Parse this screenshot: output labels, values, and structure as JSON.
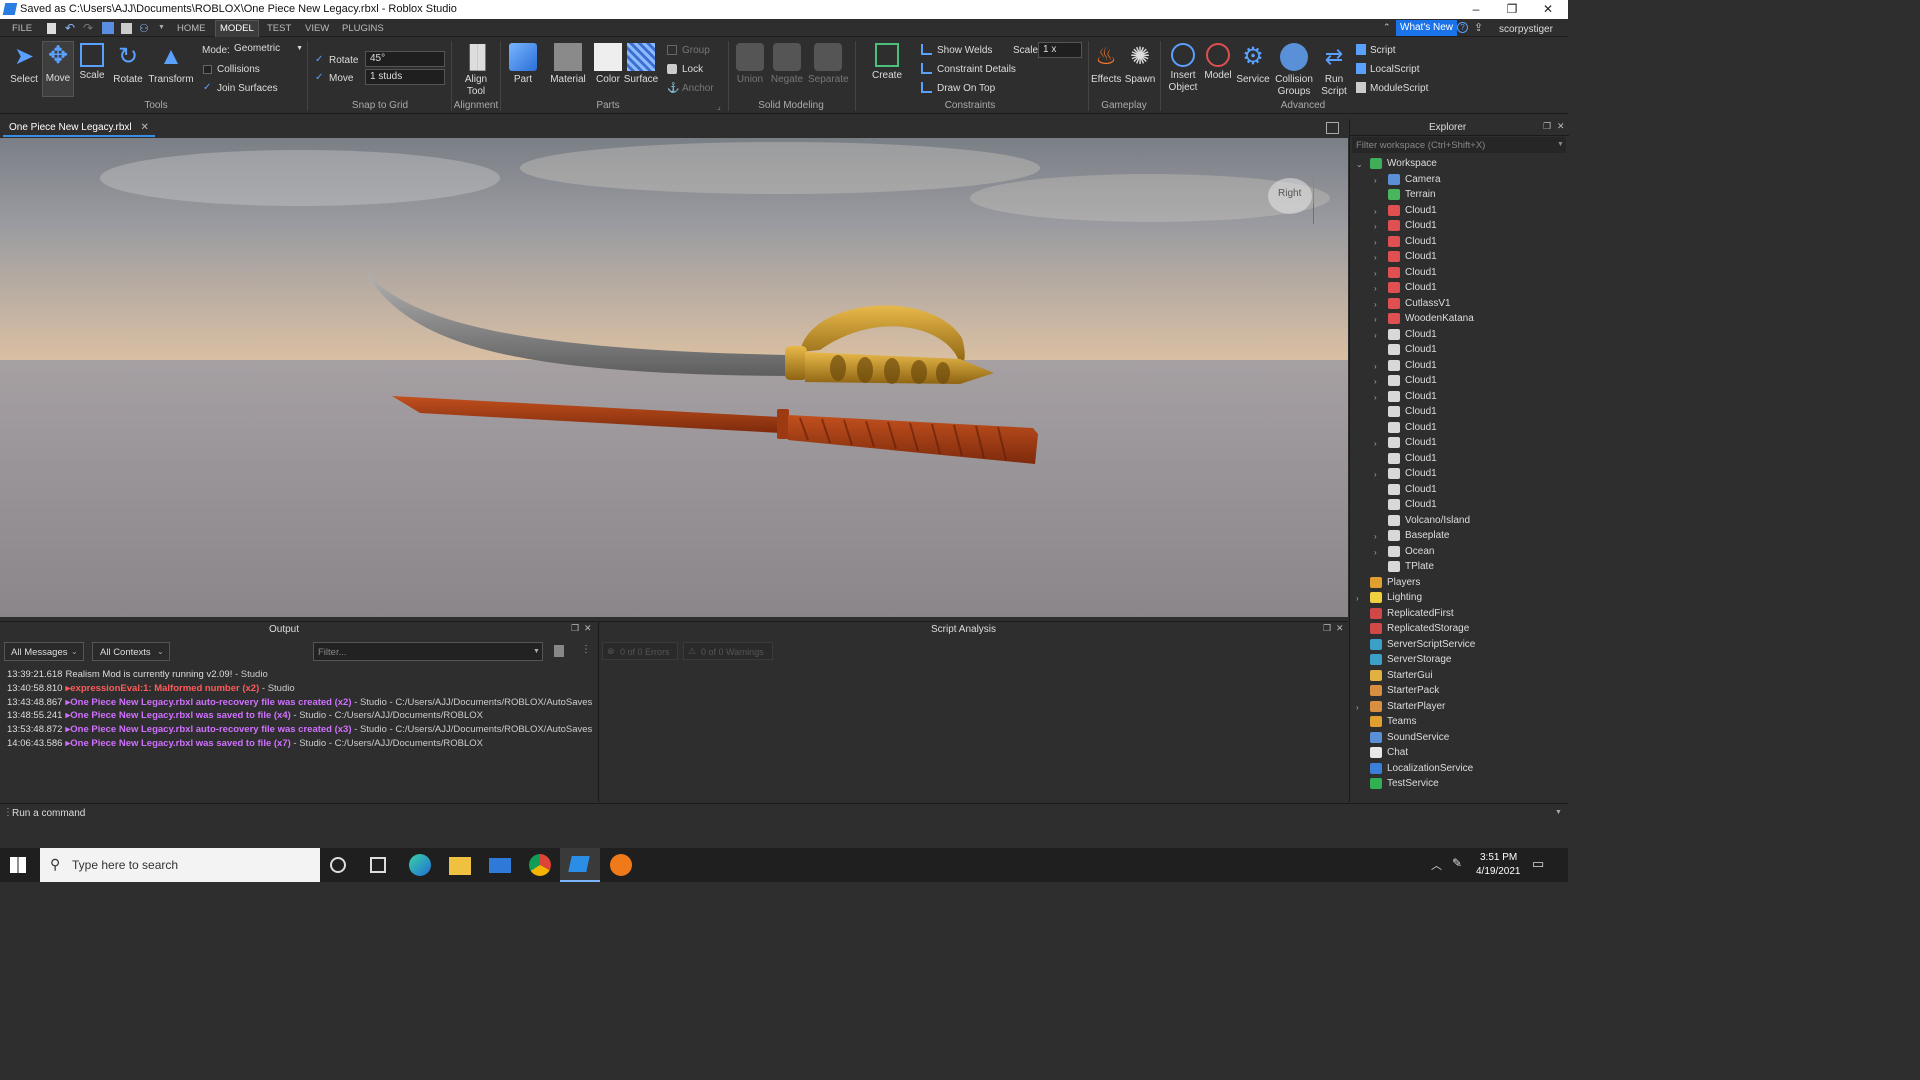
{
  "title_bar": {
    "title": "Saved as C:\\Users\\AJJ\\Documents\\ROBLOX\\One Piece New Legacy.rbxl - Roblox Studio",
    "minimize": "–",
    "maximize": "❐",
    "close": "✕"
  },
  "menu": {
    "file": "FILE",
    "home": "HOME",
    "model": "MODEL",
    "test": "TEST",
    "view": "VIEW",
    "plugins": "PLUGINS",
    "whats_new": "What's New",
    "user": "scorpystiger"
  },
  "ribbon": {
    "tools": {
      "select": "Select",
      "move": "Move",
      "scale": "Scale",
      "rotate": "Rotate",
      "transform": "Transform",
      "group": "Tools"
    },
    "mode": {
      "label": "Mode:",
      "value": "Geometric",
      "collisions": "Collisions",
      "join_surfaces": "Join Surfaces"
    },
    "snap": {
      "rotate_label": "Rotate",
      "rotate_value": "45°",
      "move_label": "Move",
      "move_value": "1 studs",
      "group": "Snap to Grid"
    },
    "alignment": {
      "align_tool": "Align Tool",
      "group": "Alignment"
    },
    "parts": {
      "part": "Part",
      "material": "Material",
      "color": "Color",
      "surface": "Surface",
      "group_btn": "Group",
      "lock": "Lock",
      "anchor": "Anchor",
      "group": "Parts"
    },
    "solid": {
      "union": "Union",
      "negate": "Negate",
      "separate": "Separate",
      "group": "Solid Modeling"
    },
    "constraints": {
      "create": "Create",
      "show_welds": "Show Welds",
      "constraint_details": "Constraint Details",
      "draw_on_top": "Draw On Top",
      "scale_label": "Scale",
      "scale_value": "1 x",
      "group": "Constraints"
    },
    "gameplay": {
      "effects": "Effects",
      "spawn": "Spawn",
      "group": "Gameplay"
    },
    "advanced": {
      "insert_object": "Insert Object",
      "model": "Model",
      "service": "Service",
      "collision_groups": "Collision Groups",
      "run_script": "Run Script",
      "script": "Script",
      "local_script": "LocalScript",
      "module_script": "ModuleScript",
      "group": "Advanced"
    }
  },
  "doc_tab": "One Piece New Legacy.rbxl",
  "viewport": {
    "view_cube_label": "Right"
  },
  "explorer": {
    "title": "Explorer",
    "filter_placeholder": "Filter workspace (Ctrl+Shift+X)",
    "items": [
      {
        "name": "Workspace",
        "color": "#3fae5a",
        "level": 0,
        "arrow": "v"
      },
      {
        "name": "Camera",
        "color": "#5b8fd6",
        "level": 1,
        "arrow": ">"
      },
      {
        "name": "Terrain",
        "color": "#49b55d",
        "level": 1,
        "arrow": ""
      },
      {
        "name": "Cloud1",
        "color": "#e05050",
        "level": 1,
        "arrow": ">"
      },
      {
        "name": "Cloud1",
        "color": "#e05050",
        "level": 1,
        "arrow": ">"
      },
      {
        "name": "Cloud1",
        "color": "#e05050",
        "level": 1,
        "arrow": ">"
      },
      {
        "name": "Cloud1",
        "color": "#e05050",
        "level": 1,
        "arrow": ">"
      },
      {
        "name": "Cloud1",
        "color": "#e05050",
        "level": 1,
        "arrow": ">"
      },
      {
        "name": "Cloud1",
        "color": "#e05050",
        "level": 1,
        "arrow": ">"
      },
      {
        "name": "CutlassV1",
        "color": "#e05050",
        "level": 1,
        "arrow": ">"
      },
      {
        "name": "WoodenKatana",
        "color": "#e05050",
        "level": 1,
        "arrow": ">"
      },
      {
        "name": "Cloud1",
        "color": "#d8d8d8",
        "level": 1,
        "arrow": ">"
      },
      {
        "name": "Cloud1",
        "color": "#d8d8d8",
        "level": 1,
        "arrow": ""
      },
      {
        "name": "Cloud1",
        "color": "#d8d8d8",
        "level": 1,
        "arrow": ">"
      },
      {
        "name": "Cloud1",
        "color": "#d8d8d8",
        "level": 1,
        "arrow": ">"
      },
      {
        "name": "Cloud1",
        "color": "#d8d8d8",
        "level": 1,
        "arrow": ">"
      },
      {
        "name": "Cloud1",
        "color": "#d8d8d8",
        "level": 1,
        "arrow": ""
      },
      {
        "name": "Cloud1",
        "color": "#d8d8d8",
        "level": 1,
        "arrow": ""
      },
      {
        "name": "Cloud1",
        "color": "#d8d8d8",
        "level": 1,
        "arrow": ">"
      },
      {
        "name": "Cloud1",
        "color": "#d8d8d8",
        "level": 1,
        "arrow": ""
      },
      {
        "name": "Cloud1",
        "color": "#d8d8d8",
        "level": 1,
        "arrow": ">"
      },
      {
        "name": "Cloud1",
        "color": "#d8d8d8",
        "level": 1,
        "arrow": ""
      },
      {
        "name": "Cloud1",
        "color": "#d8d8d8",
        "level": 1,
        "arrow": ""
      },
      {
        "name": "Volcano/Island",
        "color": "#d8d8d8",
        "level": 1,
        "arrow": ""
      },
      {
        "name": "Baseplate",
        "color": "#d8d8d8",
        "level": 1,
        "arrow": ">"
      },
      {
        "name": "Ocean",
        "color": "#d8d8d8",
        "level": 1,
        "arrow": ">"
      },
      {
        "name": "TPlate",
        "color": "#d8d8d8",
        "level": 1,
        "arrow": ""
      },
      {
        "name": "Players",
        "color": "#e0a030",
        "level": 0,
        "arrow": ""
      },
      {
        "name": "Lighting",
        "color": "#f0d040",
        "level": 0,
        "arrow": ">"
      },
      {
        "name": "ReplicatedFirst",
        "color": "#d04848",
        "level": 0,
        "arrow": ""
      },
      {
        "name": "ReplicatedStorage",
        "color": "#d04848",
        "level": 0,
        "arrow": ""
      },
      {
        "name": "ServerScriptService",
        "color": "#3aa0c8",
        "level": 0,
        "arrow": ""
      },
      {
        "name": "ServerStorage",
        "color": "#3aa0c8",
        "level": 0,
        "arrow": ""
      },
      {
        "name": "StarterGui",
        "color": "#e0b040",
        "level": 0,
        "arrow": ""
      },
      {
        "name": "StarterPack",
        "color": "#d89040",
        "level": 0,
        "arrow": ""
      },
      {
        "name": "StarterPlayer",
        "color": "#d89040",
        "level": 0,
        "arrow": ">"
      },
      {
        "name": "Teams",
        "color": "#e0a030",
        "level": 0,
        "arrow": ""
      },
      {
        "name": "SoundService",
        "color": "#5a90d8",
        "level": 0,
        "arrow": ""
      },
      {
        "name": "Chat",
        "color": "#e8e8e8",
        "level": 0,
        "arrow": ""
      },
      {
        "name": "LocalizationService",
        "color": "#3a80d8",
        "level": 0,
        "arrow": ""
      },
      {
        "name": "TestService",
        "color": "#30b050",
        "level": 0,
        "arrow": ""
      }
    ]
  },
  "output": {
    "title": "Output",
    "filter_messages": "All Messages",
    "filter_contexts": "All Contexts",
    "filter_placeholder": "Filter...",
    "lines": [
      {
        "time": "13:39:21.618",
        "msg": "Realism Mod is currently running v2.09!",
        "suffix": " - Studio",
        "color": "#dddddd",
        "bold": false
      },
      {
        "time": "13:40:58.810",
        "msg": "▸expressionEval:1: Malformed number (x2)",
        "suffix": " - Studio",
        "color": "#ff5a5a",
        "bold": true
      },
      {
        "time": "13:43:48.867",
        "msg": "▸One Piece New Legacy.rbxl auto-recovery file was created (x2)",
        "suffix": " - Studio - C:/Users/AJJ/Documents/ROBLOX/AutoSaves",
        "color": "#d070ff",
        "bold": true
      },
      {
        "time": "13:48:55.241",
        "msg": "▸One Piece New Legacy.rbxl was saved to file (x4)",
        "suffix": " - Studio - C:/Users/AJJ/Documents/ROBLOX",
        "color": "#d070ff",
        "bold": true
      },
      {
        "time": "13:53:48.872",
        "msg": "▸One Piece New Legacy.rbxl auto-recovery file was created (x3)",
        "suffix": " - Studio - C:/Users/AJJ/Documents/ROBLOX/AutoSaves",
        "color": "#d070ff",
        "bold": true
      },
      {
        "time": "14:06:43.586",
        "msg": "▸One Piece New Legacy.rbxl was saved to file (x7)",
        "suffix": " - Studio - C:/Users/AJJ/Documents/ROBLOX",
        "color": "#d070ff",
        "bold": true
      }
    ]
  },
  "script_analysis": {
    "title": "Script Analysis",
    "errors": "0 of 0 Errors",
    "warnings": "0 of 0 Warnings"
  },
  "command_bar": {
    "placeholder": "Run a command"
  },
  "taskbar": {
    "search_placeholder": "Type here to search",
    "time": "3:51 PM",
    "date": "4/19/2021"
  }
}
